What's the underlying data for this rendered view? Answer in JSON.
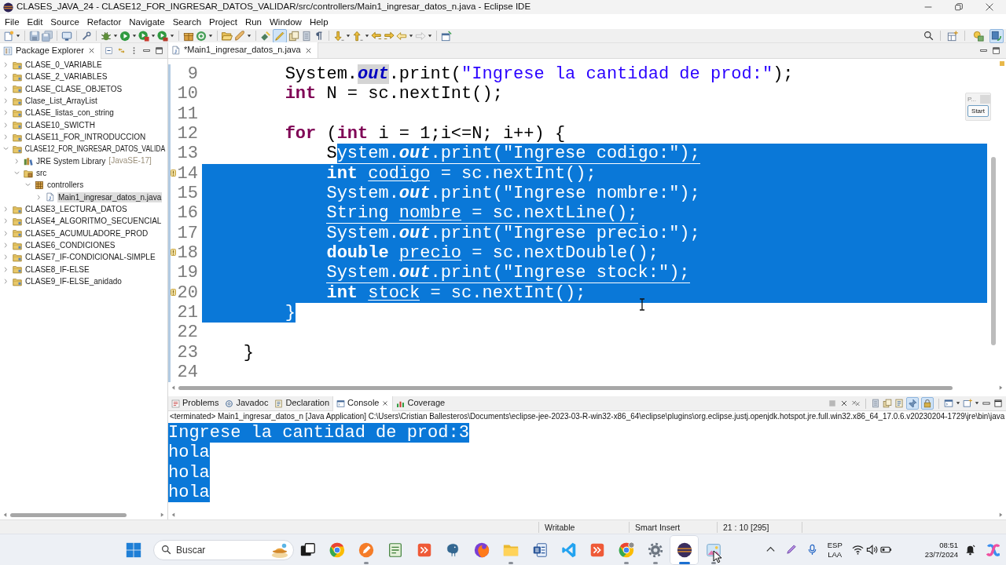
{
  "window": {
    "title": "CLASES_JAVA_24 - CLASE12_FOR_INGRESAR_DATOS_VALIDAR/src/controllers/Main1_ingresar_datos_n.java - Eclipse IDE"
  },
  "menu": [
    "File",
    "Edit",
    "Source",
    "Refactor",
    "Navigate",
    "Search",
    "Project",
    "Run",
    "Window",
    "Help"
  ],
  "toolbar": {
    "toggle_buttons": [
      {
        "selected": true
      }
    ],
    "perspectives": [
      {
        "selected": false
      },
      {
        "selected": true
      }
    ]
  },
  "package_explorer": {
    "title": "Package Explorer",
    "items": [
      {
        "label": "CLASE_0_VARIABLE",
        "kind": "project",
        "expanded": false,
        "selected": false
      },
      {
        "label": "CLASE_2_VARIABLES",
        "kind": "project",
        "expanded": false,
        "selected": false
      },
      {
        "label": "CLASE_CLASE_OBJETOS",
        "kind": "project",
        "expanded": false,
        "selected": false
      },
      {
        "label": "Clase_List_ArrayList",
        "kind": "project",
        "expanded": false,
        "selected": false
      },
      {
        "label": "CLASE_listas_con_string",
        "kind": "project",
        "expanded": false,
        "selected": false
      },
      {
        "label": "CLASE10_SWICTH",
        "kind": "project",
        "expanded": false,
        "selected": false
      },
      {
        "label": "CLASE11_FOR_INTRODUCCION",
        "kind": "project",
        "expanded": false,
        "selected": false
      },
      {
        "label": "CLASE12_FOR_INGRESAR_DATOS_VALIDA",
        "kind": "project",
        "expanded": true,
        "selected": false,
        "children": [
          {
            "label": "JRE System Library",
            "decoration": "[JavaSE-17]",
            "kind": "library",
            "expanded": false,
            "selected": false
          },
          {
            "label": "src",
            "kind": "source_folder",
            "expanded": true,
            "selected": false,
            "children": [
              {
                "label": "controllers",
                "kind": "package",
                "expanded": true,
                "selected": false,
                "children": [
                  {
                    "label": "Main1_ingresar_datos_n.java",
                    "kind": "file",
                    "expanded": false,
                    "selected": true
                  }
                ]
              }
            ]
          }
        ]
      },
      {
        "label": "CLASE3_LECTURA_DATOS",
        "kind": "project",
        "expanded": false,
        "selected": false
      },
      {
        "label": "CLASE4_ALGORITMO_SECUENCIAL",
        "kind": "project",
        "expanded": false,
        "selected": false
      },
      {
        "label": "CLASE5_ACUMULADORE_PROD",
        "kind": "project",
        "expanded": false,
        "selected": false
      },
      {
        "label": "CLASE6_CONDICIONES",
        "kind": "project",
        "expanded": false,
        "selected": false
      },
      {
        "label": "CLASE7_IF-CONDICIONAL-SIMPLE",
        "kind": "project",
        "expanded": false,
        "selected": false
      },
      {
        "label": "CLASE8_IF-ELSE",
        "kind": "project",
        "expanded": false,
        "selected": false
      },
      {
        "label": "CLASE9_IF-ELSE_anidado",
        "kind": "project",
        "expanded": false,
        "selected": false
      }
    ]
  },
  "editor": {
    "tab": {
      "label": "*Main1_ingresar_datos_n.java"
    },
    "lines": [
      {
        "number": "9",
        "marker": false,
        "selected_to_end": false,
        "segments": [
          {
            "text": "        System.",
            "kind": "plain",
            "selected": false,
            "occurrence": false
          },
          {
            "text": "out",
            "kind": "field",
            "selected": false,
            "occurrence": true
          },
          {
            "text": ".print(",
            "kind": "plain",
            "selected": false,
            "occurrence": false
          },
          {
            "text": "\"Ingrese la cantidad de prod:\"",
            "kind": "string",
            "selected": false,
            "occurrence": false
          },
          {
            "text": ");",
            "kind": "plain",
            "selected": false,
            "occurrence": false
          }
        ]
      },
      {
        "number": "10",
        "marker": false,
        "selected_to_end": false,
        "segments": [
          {
            "text": "        int",
            "kind": "keyword",
            "selected": false,
            "occurrence": false
          },
          {
            "text": " N = sc.nextInt();",
            "kind": "plain",
            "selected": false,
            "occurrence": false
          }
        ]
      },
      {
        "number": "11",
        "marker": false,
        "selected_to_end": false
      },
      {
        "number": "12",
        "marker": false,
        "selected_to_end": false,
        "segments": [
          {
            "text": "        for",
            "kind": "keyword",
            "selected": false,
            "occurrence": false
          },
          {
            "text": " (",
            "kind": "plain",
            "selected": false,
            "occurrence": false
          },
          {
            "text": "int",
            "kind": "keyword",
            "selected": false,
            "occurrence": false
          },
          {
            "text": " i = 1;i<=N; i++) {",
            "kind": "plain",
            "selected": false,
            "occurrence": false
          }
        ]
      },
      {
        "number": "13",
        "marker": false,
        "selected_to_end": true,
        "segments": [
          {
            "text": "            S",
            "kind": "plain",
            "selected": false,
            "occurrence": false
          },
          {
            "text": "ystem.",
            "kind": "plain",
            "selected": true,
            "occurrence": false
          },
          {
            "text": "out",
            "kind": "field",
            "selected": true,
            "occurrence": false
          },
          {
            "text": ".print(",
            "kind": "plain",
            "selected": true,
            "occurrence": false
          },
          {
            "text": "\"Ingrese codigo:\"",
            "kind": "string",
            "selected": true,
            "occurrence": false
          },
          {
            "text": ");",
            "kind": "plain",
            "selected": true,
            "occurrence": false
          }
        ]
      },
      {
        "number": "14",
        "marker": true,
        "selected_to_end": true,
        "segments": [
          {
            "text": "            int ",
            "kind": "keyword",
            "selected": true,
            "occurrence": false
          },
          {
            "text": "codigo",
            "kind": "unused",
            "selected": true,
            "occurrence": false
          },
          {
            "text": " = sc.nextInt();",
            "kind": "plain",
            "selected": true,
            "occurrence": false
          }
        ]
      },
      {
        "number": "15",
        "marker": false,
        "selected_to_end": true,
        "segments": [
          {
            "text": "            System.",
            "kind": "plain",
            "selected": true,
            "occurrence": false
          },
          {
            "text": "out",
            "kind": "field",
            "selected": true,
            "occurrence": false
          },
          {
            "text": ".print(",
            "kind": "plain",
            "selected": true,
            "occurrence": false
          },
          {
            "text": "\"Ingrese nombre:\"",
            "kind": "string",
            "selected": true,
            "occurrence": false
          },
          {
            "text": ");",
            "kind": "plain",
            "selected": true,
            "occurrence": false
          }
        ]
      },
      {
        "number": "16",
        "marker": false,
        "selected_to_end": true,
        "segments": [
          {
            "text": "            String ",
            "kind": "plain",
            "selected": true,
            "occurrence": false
          },
          {
            "text": "nombre",
            "kind": "unused",
            "selected": true,
            "occurrence": false
          },
          {
            "text": " = sc.nextLine();",
            "kind": "plain",
            "selected": true,
            "occurrence": false
          }
        ]
      },
      {
        "number": "17",
        "marker": false,
        "selected_to_end": true,
        "segments": [
          {
            "text": "            System.",
            "kind": "plain",
            "selected": true,
            "occurrence": false
          },
          {
            "text": "out",
            "kind": "field",
            "selected": true,
            "occurrence": false
          },
          {
            "text": ".print(",
            "kind": "plain",
            "selected": true,
            "occurrence": false
          },
          {
            "text": "\"Ingrese precio:\"",
            "kind": "string",
            "selected": true,
            "occurrence": false
          },
          {
            "text": ");",
            "kind": "plain",
            "selected": true,
            "occurrence": false
          }
        ]
      },
      {
        "number": "18",
        "marker": true,
        "selected_to_end": true,
        "segments": [
          {
            "text": "            double ",
            "kind": "keyword",
            "selected": true,
            "occurrence": false
          },
          {
            "text": "precio",
            "kind": "unused",
            "selected": true,
            "occurrence": false
          },
          {
            "text": " = sc.nextDouble();",
            "kind": "plain",
            "selected": true,
            "occurrence": false
          }
        ]
      },
      {
        "number": "19",
        "marker": false,
        "selected_to_end": true,
        "segments": [
          {
            "text": "            System.",
            "kind": "plain",
            "selected": true,
            "occurrence": false
          },
          {
            "text": "out",
            "kind": "field",
            "selected": true,
            "occurrence": false
          },
          {
            "text": ".print(",
            "kind": "plain",
            "selected": true,
            "occurrence": false
          },
          {
            "text": "\"Ingrese stock:\"",
            "kind": "string",
            "selected": true,
            "occurrence": false
          },
          {
            "text": ");",
            "kind": "plain",
            "selected": true,
            "occurrence": false
          }
        ]
      },
      {
        "number": "20",
        "marker": true,
        "selected_to_end": true,
        "segments": [
          {
            "text": "            int ",
            "kind": "keyword",
            "selected": true,
            "occurrence": false
          },
          {
            "text": "stock",
            "kind": "unused",
            "selected": true,
            "occurrence": false
          },
          {
            "text": " = sc.nextInt();",
            "kind": "plain",
            "selected": true,
            "occurrence": false
          }
        ]
      },
      {
        "number": "21",
        "marker": false,
        "selected_to_end": false,
        "segments": [
          {
            "text": "        }",
            "kind": "plain",
            "selected": true,
            "occurrence": false
          }
        ]
      },
      {
        "number": "22",
        "marker": false,
        "selected_to_end": false
      },
      {
        "number": "23",
        "marker": false,
        "selected_to_end": false,
        "segments": [
          {
            "text": "    }",
            "kind": "plain",
            "selected": false,
            "occurrence": false
          }
        ]
      },
      {
        "number": "24",
        "marker": false,
        "selected_to_end": false
      }
    ],
    "popup": {
      "label": "P...",
      "button": "Start"
    }
  },
  "bottom_panel": {
    "tabs": [
      {
        "label": "Problems",
        "selected": false
      },
      {
        "label": "Javadoc",
        "selected": false
      },
      {
        "label": "Declaration",
        "selected": false
      },
      {
        "label": "Console",
        "selected": true
      },
      {
        "label": "Coverage",
        "selected": false
      }
    ],
    "toggle_buttons": [
      {
        "selected": true
      },
      {
        "selected": true
      }
    ],
    "console_header": "<terminated> Main1_ingresar_datos_n [Java Application] C:\\Users\\Cristian Ballesteros\\Documents\\eclipse-jee-2023-03-R-win32-x86_64\\eclipse\\plugins\\org.eclipse.justj.openjdk.hotspot.jre.full.win32.x86_64_17.0.6.v20230204-1729\\jre\\bin\\java",
    "console_lines": [
      {
        "text": "Ingrese la cantidad de prod:3",
        "selected": true
      },
      {
        "text": "hola",
        "selected": true
      },
      {
        "text": "hola",
        "selected": true
      },
      {
        "text": "hola",
        "selected": true
      }
    ]
  },
  "status_bar": [
    "Writable",
    "Smart Insert",
    "21 : 10 [295]"
  ],
  "taskbar": {
    "search": {
      "placeholder": "Buscar"
    },
    "apps": [
      {
        "running": false,
        "selected": false
      },
      {
        "running": false,
        "selected": false
      },
      {
        "running": true,
        "selected": false
      },
      {
        "running": false,
        "selected": false
      },
      {
        "running": false,
        "selected": false
      },
      {
        "running": false,
        "selected": false
      },
      {
        "running": false,
        "selected": false
      },
      {
        "running": true,
        "selected": false
      },
      {
        "running": false,
        "selected": false
      },
      {
        "running": false,
        "selected": false
      },
      {
        "running": false,
        "selected": false
      },
      {
        "running": true,
        "selected": false
      },
      {
        "running": true,
        "selected": false
      },
      {
        "running": true,
        "selected": true
      },
      {
        "running": true,
        "selected": false
      }
    ],
    "language": "ESP",
    "layout": "LAA",
    "time": "08:51",
    "date": "23/7/2024"
  }
}
